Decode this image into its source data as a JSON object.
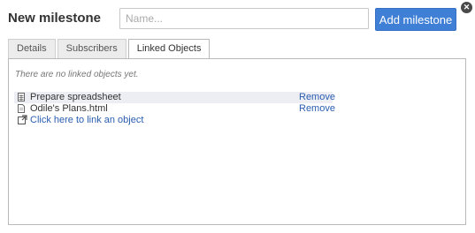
{
  "dialog": {
    "title": "New milestone",
    "name_placeholder": "Name...",
    "add_button_label": "Add milestone",
    "close_icon": "close-icon"
  },
  "tabs": [
    {
      "label": "Details",
      "active": false
    },
    {
      "label": "Subscribers",
      "active": false
    },
    {
      "label": "Linked Objects",
      "active": true
    }
  ],
  "linked_objects": {
    "empty_message": "There are no linked objects yet.",
    "items": [
      {
        "icon": "spreadsheet-icon",
        "label": "Prepare spreadsheet",
        "action": "Remove",
        "highlighted": true
      },
      {
        "icon": "document-icon",
        "label": "Odile's Plans.html",
        "action": "Remove",
        "highlighted": false
      }
    ],
    "link_action": {
      "icon": "external-link-icon",
      "label": "Click here to link an object"
    }
  },
  "colors": {
    "accent": "#3f7fd6",
    "link": "#2a5db0"
  }
}
